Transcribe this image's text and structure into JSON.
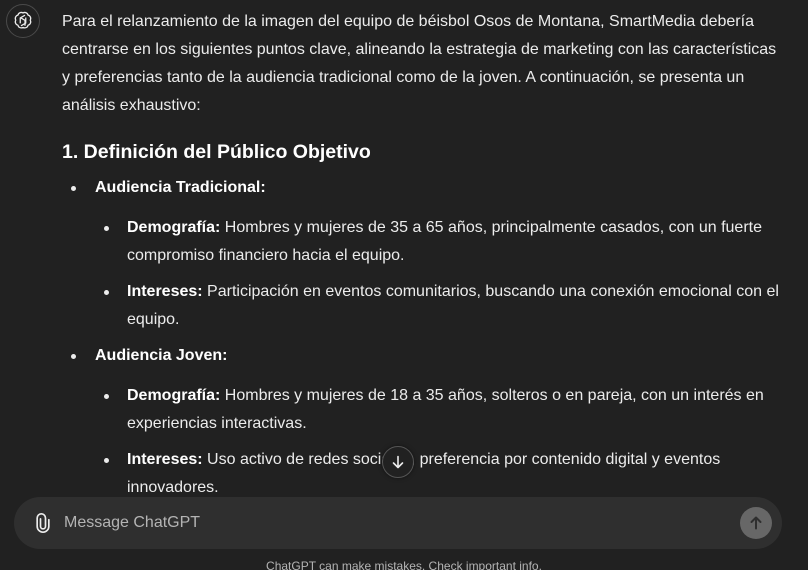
{
  "assistant": {
    "avatar_icon": "openai-logo-icon"
  },
  "message": {
    "intro": "Para el relanzamiento de la imagen del equipo de béisbol Osos de Montana, SmartMedia debería centrarse en los siguientes puntos clave, alineando la estrategia de marketing con las características y preferencias tanto de la audiencia tradicional como de la joven. A continuación, se presenta un análisis exhaustivo:",
    "heading": "1. Definición del Público Objetivo",
    "groups": [
      {
        "label": "Audiencia Tradicional:",
        "items": [
          {
            "term": "Demografía:",
            "text": " Hombres y mujeres de 35 a 65 años, principalmente casados, con un fuerte compromiso financiero hacia el equipo."
          },
          {
            "term": "Intereses:",
            "text": " Participación en eventos comunitarios, buscando una conexión emocional con el equipo."
          }
        ]
      },
      {
        "label": "Audiencia Joven:",
        "items": [
          {
            "term": "Demografía:",
            "text": " Hombres y mujeres de 18 a 35 años, solteros o en pareja, con un interés en experiencias interactivas."
          },
          {
            "term": "Intereses:",
            "text": " Uso activo de redes sociales, preferencia por contenido digital y eventos innovadores."
          }
        ]
      }
    ]
  },
  "composer": {
    "placeholder": "Message ChatGPT",
    "attach_icon": "paperclip-icon",
    "send_icon": "arrow-up-icon"
  },
  "scroll_button": {
    "icon": "arrow-down-icon"
  },
  "footer": {
    "disclaimer": "ChatGPT can make mistakes. Check important info."
  }
}
